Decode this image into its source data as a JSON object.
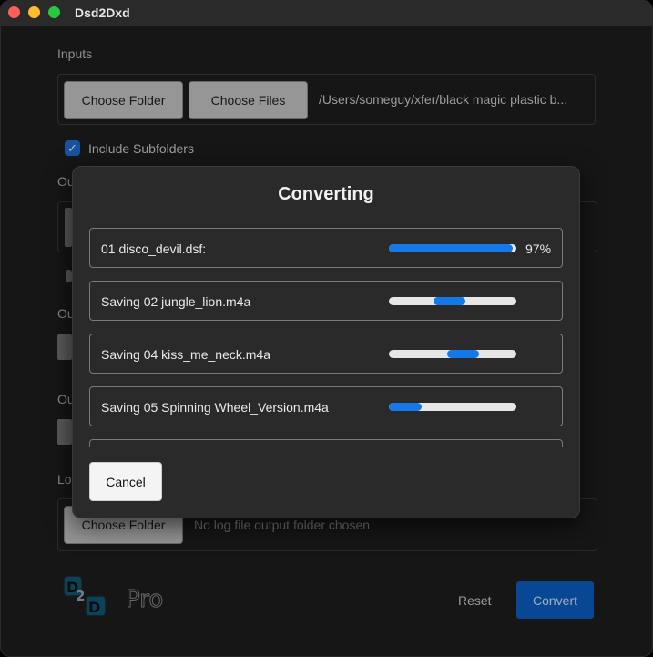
{
  "window": {
    "title": "Dsd2Dxd"
  },
  "inputs": {
    "label": "Inputs",
    "choose_folder": "Choose Folder",
    "choose_files": "Choose Files",
    "path": "/Users/someguy/xfer/black magic plastic b...",
    "include_subfolders": "Include Subfolders",
    "include_subfolders_checked": true
  },
  "partial_labels": {
    "output1": "Ou",
    "output2": "Ou",
    "output3": "Ou",
    "log": "Lo"
  },
  "log": {
    "choose_folder": "Choose Folder",
    "status": "No log file output folder chosen"
  },
  "footer": {
    "logo_text": "Pro",
    "reset": "Reset",
    "convert": "Convert"
  },
  "dialog": {
    "title": "Converting",
    "jobs": [
      {
        "label": "01 disco_devil.dsf:",
        "progress": 0.97,
        "percent": "97%"
      },
      {
        "label": "Saving 02 jungle_lion.m4a",
        "indeterminate_start": 0.35,
        "indeterminate_end": 0.6
      },
      {
        "label": "Saving 04 kiss_me_neck.m4a",
        "indeterminate_start": 0.46,
        "indeterminate_end": 0.71
      },
      {
        "label": "Saving 05 Spinning Wheel_Version.m4a",
        "indeterminate_start": 0.0,
        "indeterminate_end": 0.26
      }
    ],
    "cancel": "Cancel"
  },
  "colors": {
    "accent": "#1478e8",
    "convert_bg": "#0b5fc5"
  }
}
